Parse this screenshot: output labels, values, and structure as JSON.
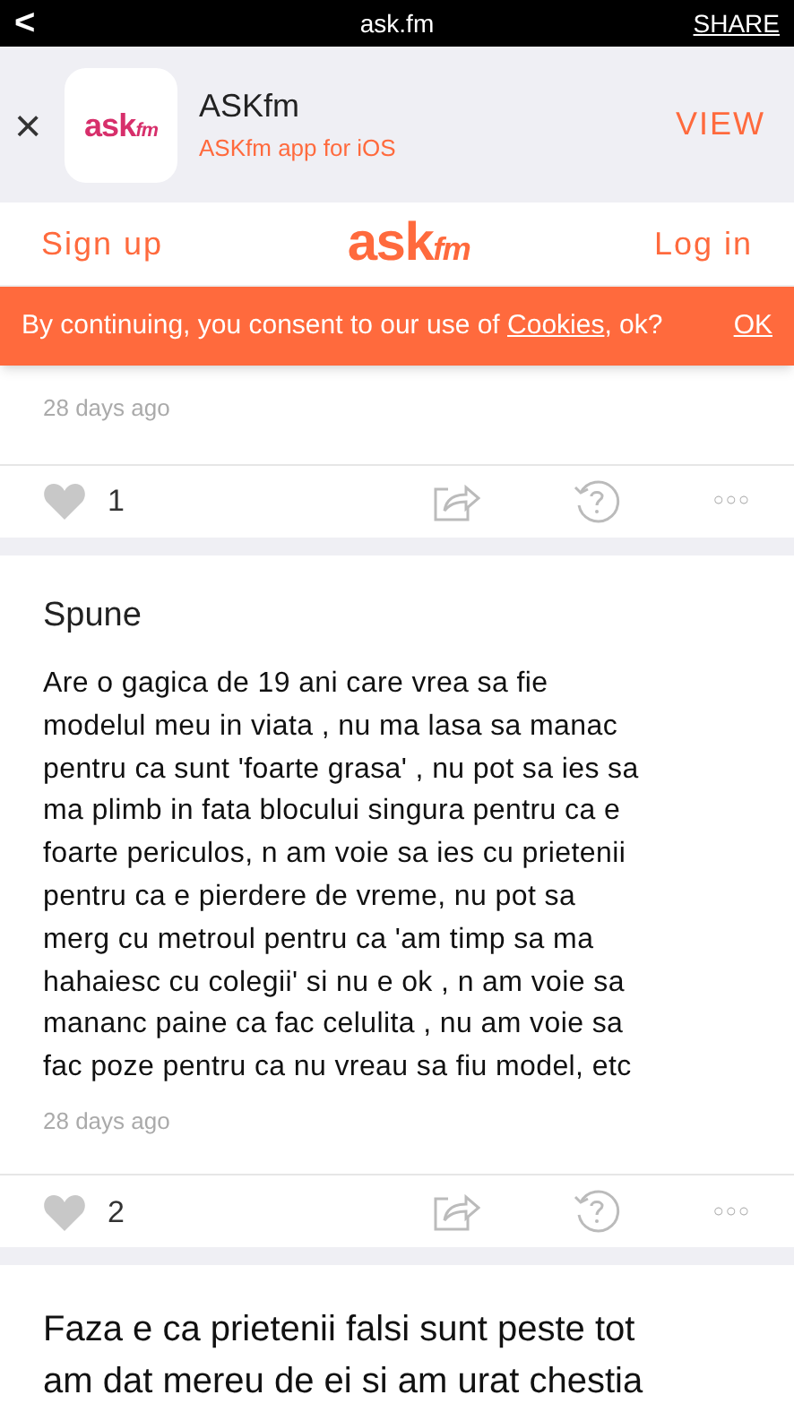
{
  "top_bar": {
    "back": "<",
    "title": "ask.fm",
    "share": "SHARE"
  },
  "app_banner": {
    "close": "×",
    "logo": "askfm",
    "name": "ASKfm",
    "subtitle": "ASKfm app for iOS",
    "action": "VIEW"
  },
  "nav": {
    "sign_up": "Sign up",
    "logo": "askfm",
    "log_in": "Log in"
  },
  "cookie_bar": {
    "before": "By continuing, you consent to our use of ",
    "link": "Cookies",
    "after": ", ok?",
    "ok": "OK"
  },
  "posts": [
    {
      "time": "28 days ago",
      "likes": "1",
      "more": "○○○"
    },
    {
      "title": "Spune",
      "text": "Are o gagica de 19 ani care vrea sa fie\nmodelul meu in viata , nu ma lasa sa manac\npentru ca sunt 'foarte grasa' , nu pot sa ies sa\nma plimb in fata blocului singura pentru ca e\nfoarte periculos, n am voie sa ies cu prietenii\npentru ca e pierdere de vreme, nu pot sa\nmerg cu metroul pentru ca 'am timp sa ma\nhahaiesc cu colegii' si nu e ok , n am voie sa\nmananc paine ca fac celulita , nu am voie sa\nfac poze pentru ca nu vreau sa fiu model, etc",
      "time": "28 days ago",
      "likes": "2",
      "more": "○○○"
    },
    {
      "text": "Faza e ca prietenii falsi sunt peste tot\nam dat mereu de ei si am urat chestia"
    }
  ]
}
